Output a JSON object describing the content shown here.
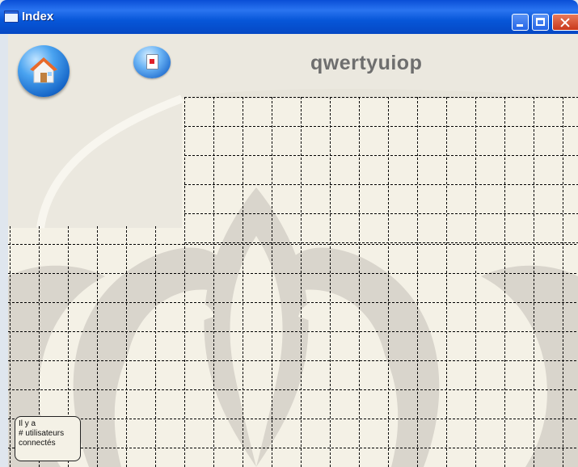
{
  "window": {
    "title": "Index"
  },
  "header": {
    "title": "qwertyuiop"
  },
  "toolbar": {
    "home_icon": "home-icon",
    "close_document_icon": "close-document-icon"
  },
  "status": {
    "line1": "Il y a",
    "line2": "# utilisateurs",
    "line3": "connectés"
  },
  "colors": {
    "titlebar": "#0756d8",
    "client_background": "#f4f1e6",
    "watermark": "#d9d5cc",
    "grid_line": "#000000"
  }
}
